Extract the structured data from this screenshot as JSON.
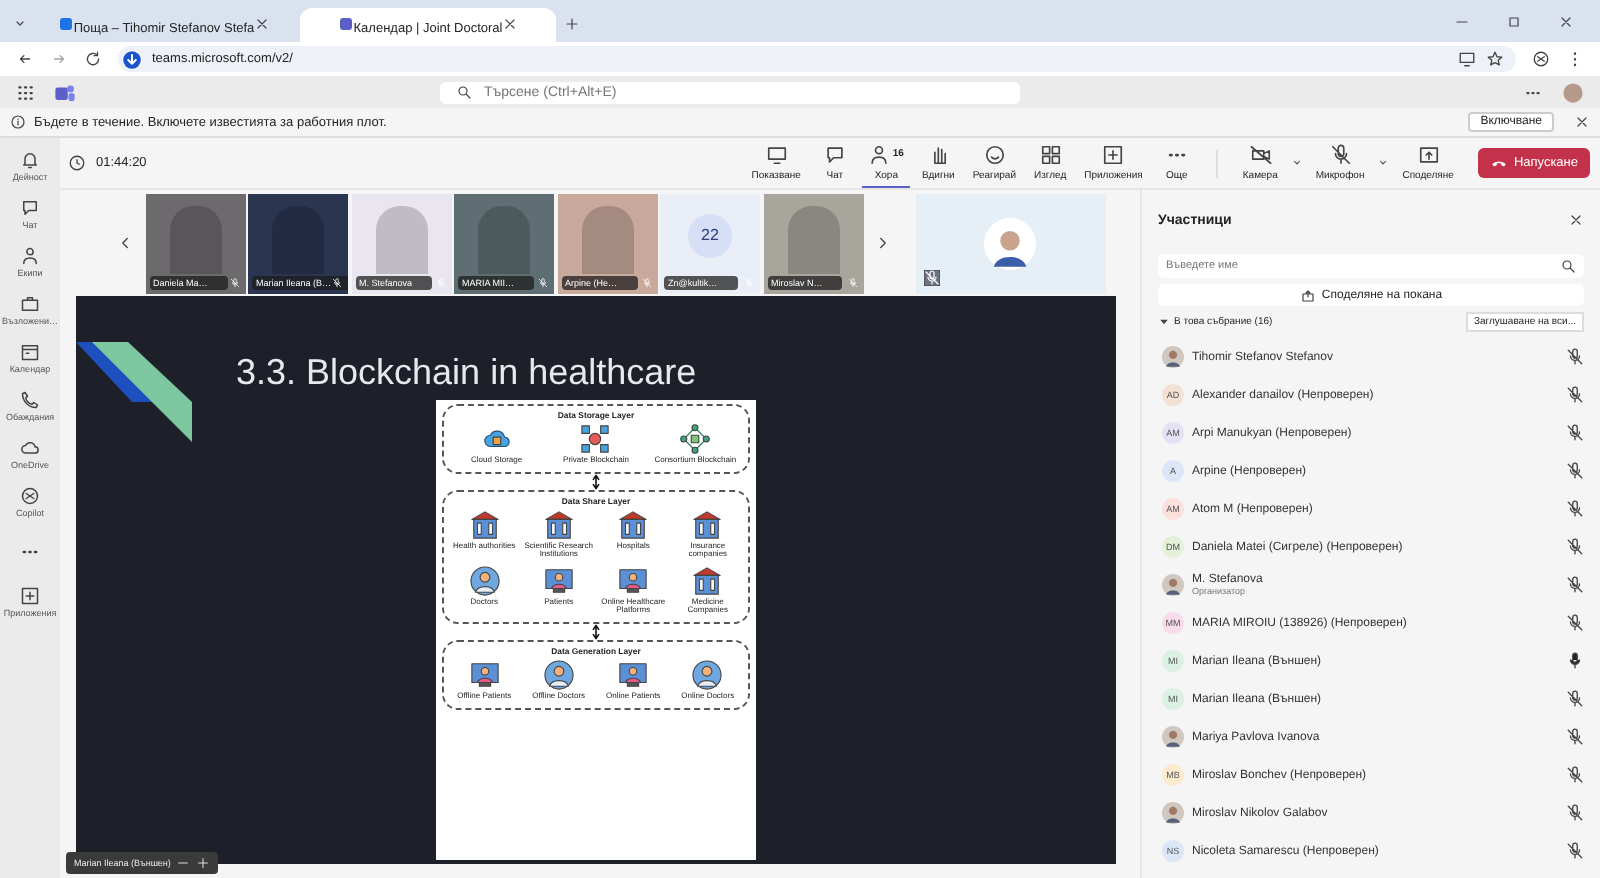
{
  "browser": {
    "tabs": [
      {
        "title": "Поща – Tihomir Stefanov Stefa",
        "selected": false
      },
      {
        "title": "Календар | Joint Doctoral",
        "selected": true
      }
    ],
    "url": "teams.microsoft.com/v2/"
  },
  "teams_bar": {
    "search_placeholder": "Търсене (Ctrl+Alt+E)"
  },
  "notification": {
    "text": "Бъдете в течение. Включете известията за работния плот.",
    "button": "Включване"
  },
  "rail": [
    {
      "label": "Дейност"
    },
    {
      "label": "Чат"
    },
    {
      "label": "Екипи"
    },
    {
      "label": "Възложени…"
    },
    {
      "label": "Календар"
    },
    {
      "label": "Обаждания"
    },
    {
      "label": "OneDrive"
    },
    {
      "label": "Copilot"
    },
    {
      "label": "Приложения"
    }
  ],
  "meeting": {
    "timer": "01:44:20",
    "tools": [
      {
        "label": "Показване",
        "selected": false
      },
      {
        "label": "Чат",
        "selected": false
      },
      {
        "label": "Хора",
        "count": "16",
        "selected": true
      },
      {
        "label": "Вдигни",
        "selected": false
      },
      {
        "label": "Реагирай",
        "selected": false
      },
      {
        "label": "Изглед",
        "selected": false
      },
      {
        "label": "Приложения",
        "selected": false
      },
      {
        "label": "Още",
        "selected": false
      }
    ],
    "devices": [
      {
        "label": "Камера"
      },
      {
        "label": "Микрофон"
      },
      {
        "label": "Споделяне"
      }
    ],
    "leave": "Напускане"
  },
  "thumbnails": [
    {
      "name": "Daniela Ma…",
      "kind": "photo"
    },
    {
      "name": "Marian Ileana (B…",
      "kind": "photo"
    },
    {
      "name": "M. Stefanova",
      "kind": "photo"
    },
    {
      "name": "MARIA MII…",
      "kind": "photo"
    },
    {
      "name": "Arpine (Не…",
      "kind": "photo"
    },
    {
      "name": "Zn@kultik…",
      "kind": "avatar",
      "initials": "22"
    },
    {
      "name": "Miroslav N…",
      "kind": "photo"
    }
  ],
  "slide": {
    "title": "3.3. Blockchain in healthcare",
    "layers": [
      {
        "title": "Data Storage Layer",
        "items": [
          {
            "label": "Cloud Storage",
            "kind": "cloud"
          },
          {
            "label": "Private Blockchain",
            "kind": "blocks"
          },
          {
            "label": "Consortium Blockchain",
            "kind": "network"
          }
        ]
      },
      {
        "title": "Data Share Layer",
        "items": [
          {
            "label": "Health authorities",
            "kind": "building"
          },
          {
            "label": "Scientific Research Institutions",
            "kind": "building"
          },
          {
            "label": "Hospitals",
            "kind": "building"
          },
          {
            "label": "Insurance companies",
            "kind": "building"
          },
          {
            "label": "Doctors",
            "kind": "people"
          },
          {
            "label": "Patients",
            "kind": "monitor"
          },
          {
            "label": "Online Healthcare Platforms",
            "kind": "monitor"
          },
          {
            "label": "Medicine Companies",
            "kind": "building"
          }
        ]
      },
      {
        "title": "Data Generation Layer",
        "items": [
          {
            "label": "Offline Patients",
            "kind": "monitor"
          },
          {
            "label": "Offline Doctors",
            "kind": "people"
          },
          {
            "label": "Online Patients",
            "kind": "monitor"
          },
          {
            "label": "Online Doctors",
            "kind": "people"
          }
        ]
      }
    ]
  },
  "caption": {
    "name": "Marian Ileana (Външен)"
  },
  "participants": {
    "title": "Участници",
    "search_placeholder": "Въведете име",
    "share_button": "Споделяне на покана",
    "group": "В това събрание (16)",
    "mute_all": "Заглушаване на вси...",
    "people": [
      {
        "name": "Tihomir Stefanov Stefanov",
        "kind": "photo",
        "muted": true
      },
      {
        "name": "Alexander danailov (Непроверен)",
        "kind": "initials",
        "initials": "AD",
        "color": "#f3e1d6",
        "muted": true
      },
      {
        "name": "Arpi Manukyan (Непроверен)",
        "kind": "initials",
        "initials": "AM",
        "color": "#e6e0f5",
        "muted": true
      },
      {
        "name": "Arpine (Непроверен)",
        "kind": "initials",
        "initials": "A",
        "color": "#dbe6f7",
        "muted": true
      },
      {
        "name": "Atom M (Непроверен)",
        "kind": "initials",
        "initials": "AM",
        "color": "#fbe0de",
        "muted": true
      },
      {
        "name": "Daniela Matei (Сигреле) (Непроверен)",
        "kind": "initials",
        "initials": "DM",
        "color": "#e4f0d8",
        "muted": true
      },
      {
        "name": "M. Stefanova",
        "role": "Организатор",
        "kind": "photo",
        "muted": true
      },
      {
        "name": "MARIA MIROIU (138926) (Непроверен)",
        "kind": "initials",
        "initials": "MM",
        "color": "#f8dcec",
        "muted": true
      },
      {
        "name": "Marian Ileana (Външен)",
        "kind": "initials",
        "initials": "MI",
        "color": "#dcf0e4",
        "muted": false
      },
      {
        "name": "Marian Ileana (Външен)",
        "kind": "initials",
        "initials": "MI",
        "color": "#dcf0e4",
        "muted": true
      },
      {
        "name": "Mariya Pavlova Ivanova",
        "kind": "photo",
        "muted": true
      },
      {
        "name": "Miroslav Bonchev (Непроверен)",
        "kind": "initials",
        "initials": "MB",
        "color": "#fdebd0",
        "muted": true
      },
      {
        "name": "Miroslav Nikolov Galabov",
        "kind": "photo",
        "muted": true
      },
      {
        "name": "Nicoleta Samarescu (Непроверен)",
        "kind": "initials",
        "initials": "NS",
        "color": "#dbe6f7",
        "muted": true
      }
    ]
  }
}
